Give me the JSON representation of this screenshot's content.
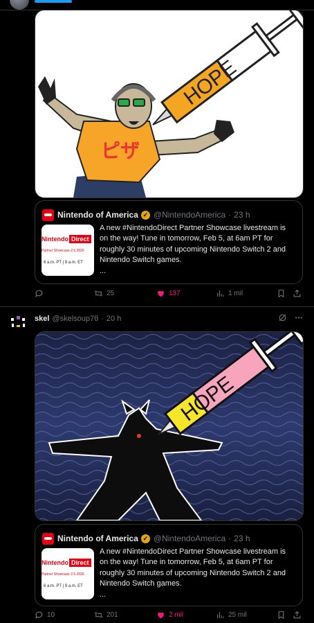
{
  "post1": {
    "image_text": "HOPE",
    "shirt_text": "ピザ",
    "quote": {
      "name": "Nintendo of America",
      "handle": "@NintendoAmerica",
      "dot": "·",
      "time": "23 h",
      "thumb": {
        "brand": "Nintendo",
        "box": "Direct",
        "sub": "Partner Showcase 2.5.2026",
        "time": "6 a.m. PT | 9 a.m. ET"
      },
      "text": "A new #NintendoDirect Partner Showcase livestream is on the way! Tune in tomorrow, Feb 5, at 6am PT for roughly 30 minutes of upcoming Nintendo Switch 2 and Nintendo Switch games.",
      "more": "..."
    },
    "actions": {
      "replies": "",
      "reposts": "25",
      "likes": "137",
      "views": "1 mil"
    }
  },
  "post2": {
    "author": {
      "name": "skel",
      "handle": "@skelsoup7θ",
      "dot": "·",
      "time": "20 h"
    },
    "image_text": "HOPE",
    "quote": {
      "name": "Nintendo of America",
      "handle": "@NintendoAmerica",
      "dot": "·",
      "time": "23 h",
      "thumb": {
        "brand": "Nintendo",
        "box": "Direct",
        "sub": "Partner Showcase 2.5.2026",
        "time": "6 a.m. PT | 9 a.m. ET"
      },
      "text": "A new #NintendoDirect Partner Showcase livestream is on the way! Tune in tomorrow, Feb 5, at 6am PT for roughly 30 minutes of upcoming Nintendo Switch 2 and Nintendo Switch games.",
      "more": "..."
    },
    "actions": {
      "replies": "10",
      "reposts": "201",
      "likes": "2 mil",
      "views": "25 mil"
    }
  },
  "colors": {
    "accent": "#1d9bf0",
    "like": "#f91880",
    "nintendo_red": "#e60012",
    "verified": "#e3a511"
  }
}
